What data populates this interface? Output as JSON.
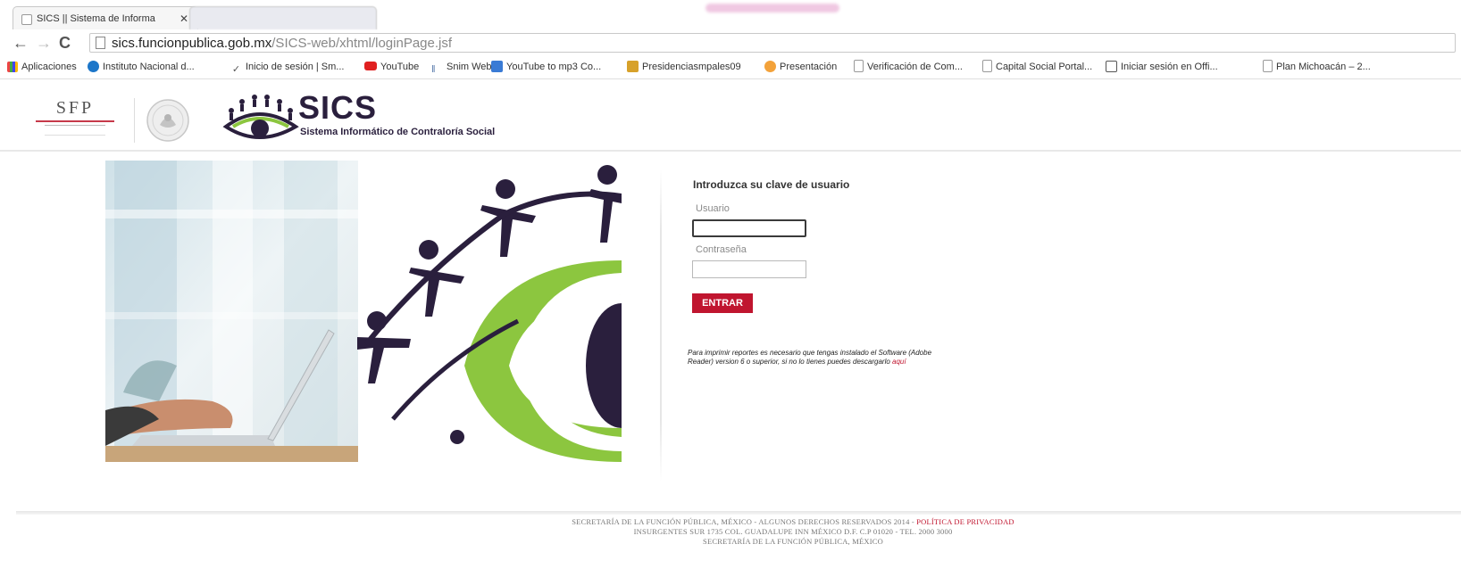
{
  "browser": {
    "active_tab_title": "SICS || Sistema de Informa",
    "url_host": "sics.funcionpublica.gob.mx",
    "url_path": "/SICS-web/xhtml/loginPage.jsf",
    "bookmarks": [
      "Aplicaciones",
      "Instituto Nacional d...",
      "Inicio de sesión | Sm...",
      "YouTube",
      "Snim Web",
      "YouTube to mp3 Co...",
      "Presidenciasmpales09",
      "Presentación",
      "Verificación de Com...",
      "Capital Social Portal...",
      "Iniciar sesión en Offi...",
      "Plan Michoacán – 2..."
    ]
  },
  "header": {
    "sfp_logo_text": "SFP",
    "app_name": "SICS",
    "app_subtitle": "Sistema Informático de Contraloría Social"
  },
  "login": {
    "title": "Introduzca su clave de usuario",
    "user_label": "Usuario",
    "user_value": "",
    "password_label": "Contraseña",
    "password_value": "",
    "submit_label": "ENTRAR",
    "note_text": "Para imprimir reportes es necesario que tengas instalado el Software (Adobe Reader) version 6 o superior, si no lo tienes puedes descargarlo",
    "note_link": "aquí"
  },
  "footer": {
    "line1": "SECRETARÍA DE LA FUNCIÓN PÚBLICA, MÉXICO - ALGUNOS DERECHOS RESERVADOS 2014 -",
    "privacy_link": "POLÍTICA DE PRIVACIDAD",
    "line2": "INSURGENTES SUR 1735 COL. GUADALUPE INN MÉXICO D.F. C.P 01020 - TEL. 2000 3000",
    "line3": "SECRETARÍA DE LA FUNCIÓN PÚBLICA, MÉXICO"
  },
  "colors": {
    "accent_red": "#c0152f",
    "logo_purple": "#2a1f3d",
    "logo_green": "#8cc63f"
  }
}
